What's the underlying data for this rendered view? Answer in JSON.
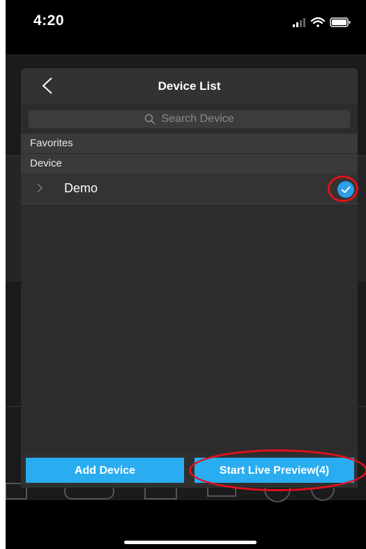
{
  "status_bar": {
    "time": "4:20"
  },
  "dialog": {
    "title": "Device List",
    "search": {
      "placeholder": "Search Device",
      "value": ""
    },
    "groups": [
      {
        "label": "Favorites"
      },
      {
        "label": "Device"
      }
    ],
    "devices": [
      {
        "label": "Demo",
        "selected": true
      }
    ],
    "buttons": {
      "add_label": "Add Device",
      "start_label": "Start Live Preview(4)"
    }
  },
  "colors": {
    "accent": "#29adf0",
    "check": "#2d9ee8",
    "annotation": "#e3101c",
    "sheet": "#2c2c2c"
  }
}
